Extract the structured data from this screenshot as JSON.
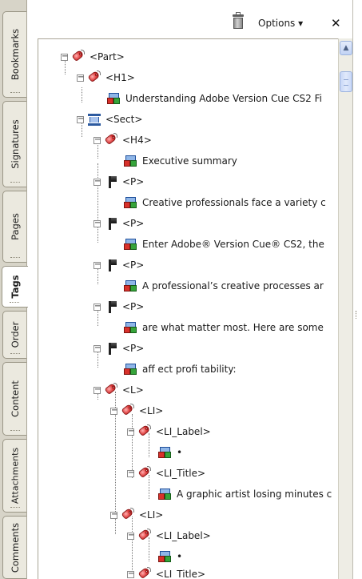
{
  "sidebar": {
    "tabs": [
      {
        "label": "Bookmarks"
      },
      {
        "label": "Signatures"
      },
      {
        "label": "Pages"
      },
      {
        "label": "Tags"
      },
      {
        "label": "Order"
      },
      {
        "label": "Content"
      },
      {
        "label": "Attachments"
      },
      {
        "label": "Comments"
      }
    ],
    "active_tab": "Tags"
  },
  "toolbar": {
    "trash_icon": "trash-icon",
    "options_label": "Options ▾",
    "close_label": "✕"
  },
  "icons": {
    "tag": "tag-icon",
    "content": "content-item-icon",
    "paragraph": "paragraph-tag-icon",
    "section": "section-tag-icon"
  },
  "colors": {
    "tab_strip": "#d7d4c8",
    "tag_red": "#e03b3b",
    "scroll_blue": "#c8d7f7"
  },
  "tree": {
    "rows": [
      {
        "label": "<Part>"
      },
      {
        "label": "<H1>"
      },
      {
        "label": "Understanding Adobe Version Cue CS2 Fi"
      },
      {
        "label": "<Sect>"
      },
      {
        "label": "<H4>"
      },
      {
        "label": "Executive summary"
      },
      {
        "label": "<P>"
      },
      {
        "label": "Creative professionals face a variety c"
      },
      {
        "label": "<P>"
      },
      {
        "label": "Enter Adobe® Version Cue® CS2, the"
      },
      {
        "label": "<P>"
      },
      {
        "label": "A professional’s creative processes ar"
      },
      {
        "label": "<P>"
      },
      {
        "label": "are what matter most. Here are some"
      },
      {
        "label": "<P>"
      },
      {
        "label": "aff ect profi tability:"
      },
      {
        "label": "<L>"
      },
      {
        "label": "<LI>"
      },
      {
        "label": "<LI_Label>"
      },
      {
        "label": "•"
      },
      {
        "label": "<LI_Title>"
      },
      {
        "label": "A graphic artist losing minutes c"
      },
      {
        "label": "<LI>"
      },
      {
        "label": "<LI_Label>"
      },
      {
        "label": "•"
      },
      {
        "label": "<LI_Title>"
      }
    ]
  }
}
